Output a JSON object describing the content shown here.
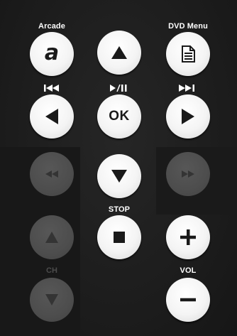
{
  "labels": {
    "arcade": "Arcade",
    "dvd_menu": "DVD Menu",
    "stop": "STOP",
    "ch": "CH",
    "vol": "VOL"
  },
  "buttons": {
    "arcade": "a",
    "ok": "OK",
    "vol_up": "+",
    "vol_down": "−"
  },
  "icons": {
    "arcade": "arcade-a-icon",
    "up": "triangle-up-icon",
    "dvd_menu": "document-icon",
    "prev_track": "skip-back-icon",
    "play_pause": "play-pause-icon",
    "next_track": "skip-forward-icon",
    "left": "triangle-left-icon",
    "right": "triangle-right-icon",
    "rewind": "rewind-icon",
    "down": "triangle-down-icon",
    "fast_forward": "fast-forward-icon",
    "stop": "square-stop-icon",
    "ch_up": "triangle-up-icon",
    "ch_down": "triangle-down-icon"
  },
  "colors": {
    "background": "#1d1d1d",
    "button_active": "#f4f4f4",
    "button_disabled": "#4d4d4d",
    "glyph": "#1a1a1a",
    "label": "#ffffff"
  }
}
